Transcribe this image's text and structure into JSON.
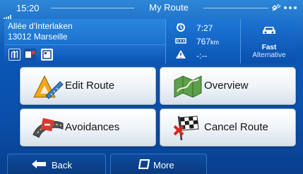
{
  "status_bar": {
    "time": "15:20",
    "title": "My Route"
  },
  "route_info": {
    "address_line1": "Allée d'Interlaken",
    "address_line2": "13012 Marseille",
    "arrival_time": "7:27",
    "distance_value": "767",
    "distance_unit": "km",
    "remaining_time": "-:--",
    "mode_label": "Fast",
    "mode_sublabel": "Alternative"
  },
  "menu": {
    "edit_route": "Edit Route",
    "overview": "Overview",
    "avoidances": "Avoidances",
    "cancel_route": "Cancel Route"
  },
  "bottom_bar": {
    "back": "Back",
    "more": "More"
  },
  "icons": {
    "signal": "signal-icon",
    "satellite": "satellite-icon",
    "more_dots": "dots-icon",
    "clock_flag": "arrival-flag-icon",
    "distance": "distance-icon",
    "warning": "warning-triangle-icon",
    "car": "car-icon",
    "edit_route": "ruler-triangle-icon",
    "overview": "map-icon",
    "avoidances": "road-avoid-icon",
    "cancel_route": "checkered-flag-icon",
    "back": "left-arrow-icon",
    "more": "more-menu-icon"
  }
}
